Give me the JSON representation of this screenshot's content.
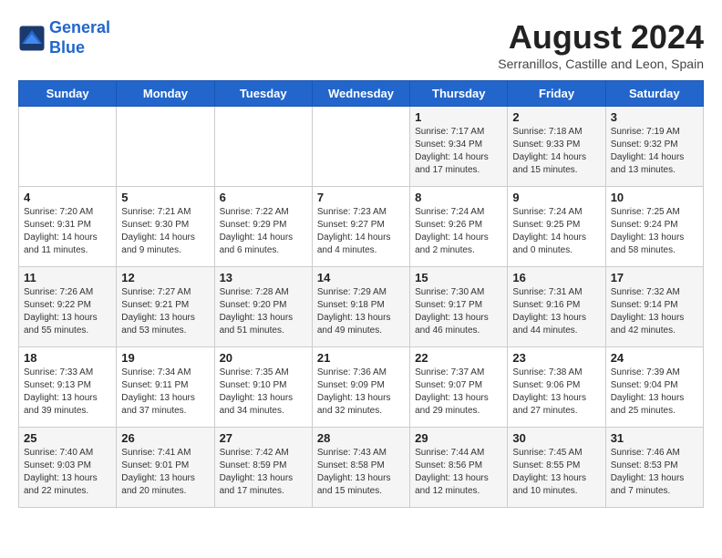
{
  "header": {
    "logo_line1": "General",
    "logo_line2": "Blue",
    "month_title": "August 2024",
    "subtitle": "Serranillos, Castille and Leon, Spain"
  },
  "weekdays": [
    "Sunday",
    "Monday",
    "Tuesday",
    "Wednesday",
    "Thursday",
    "Friday",
    "Saturday"
  ],
  "weeks": [
    [
      {
        "day": "",
        "info": ""
      },
      {
        "day": "",
        "info": ""
      },
      {
        "day": "",
        "info": ""
      },
      {
        "day": "",
        "info": ""
      },
      {
        "day": "1",
        "info": "Sunrise: 7:17 AM\nSunset: 9:34 PM\nDaylight: 14 hours\nand 17 minutes."
      },
      {
        "day": "2",
        "info": "Sunrise: 7:18 AM\nSunset: 9:33 PM\nDaylight: 14 hours\nand 15 minutes."
      },
      {
        "day": "3",
        "info": "Sunrise: 7:19 AM\nSunset: 9:32 PM\nDaylight: 14 hours\nand 13 minutes."
      }
    ],
    [
      {
        "day": "4",
        "info": "Sunrise: 7:20 AM\nSunset: 9:31 PM\nDaylight: 14 hours\nand 11 minutes."
      },
      {
        "day": "5",
        "info": "Sunrise: 7:21 AM\nSunset: 9:30 PM\nDaylight: 14 hours\nand 9 minutes."
      },
      {
        "day": "6",
        "info": "Sunrise: 7:22 AM\nSunset: 9:29 PM\nDaylight: 14 hours\nand 6 minutes."
      },
      {
        "day": "7",
        "info": "Sunrise: 7:23 AM\nSunset: 9:27 PM\nDaylight: 14 hours\nand 4 minutes."
      },
      {
        "day": "8",
        "info": "Sunrise: 7:24 AM\nSunset: 9:26 PM\nDaylight: 14 hours\nand 2 minutes."
      },
      {
        "day": "9",
        "info": "Sunrise: 7:24 AM\nSunset: 9:25 PM\nDaylight: 14 hours\nand 0 minutes."
      },
      {
        "day": "10",
        "info": "Sunrise: 7:25 AM\nSunset: 9:24 PM\nDaylight: 13 hours\nand 58 minutes."
      }
    ],
    [
      {
        "day": "11",
        "info": "Sunrise: 7:26 AM\nSunset: 9:22 PM\nDaylight: 13 hours\nand 55 minutes."
      },
      {
        "day": "12",
        "info": "Sunrise: 7:27 AM\nSunset: 9:21 PM\nDaylight: 13 hours\nand 53 minutes."
      },
      {
        "day": "13",
        "info": "Sunrise: 7:28 AM\nSunset: 9:20 PM\nDaylight: 13 hours\nand 51 minutes."
      },
      {
        "day": "14",
        "info": "Sunrise: 7:29 AM\nSunset: 9:18 PM\nDaylight: 13 hours\nand 49 minutes."
      },
      {
        "day": "15",
        "info": "Sunrise: 7:30 AM\nSunset: 9:17 PM\nDaylight: 13 hours\nand 46 minutes."
      },
      {
        "day": "16",
        "info": "Sunrise: 7:31 AM\nSunset: 9:16 PM\nDaylight: 13 hours\nand 44 minutes."
      },
      {
        "day": "17",
        "info": "Sunrise: 7:32 AM\nSunset: 9:14 PM\nDaylight: 13 hours\nand 42 minutes."
      }
    ],
    [
      {
        "day": "18",
        "info": "Sunrise: 7:33 AM\nSunset: 9:13 PM\nDaylight: 13 hours\nand 39 minutes."
      },
      {
        "day": "19",
        "info": "Sunrise: 7:34 AM\nSunset: 9:11 PM\nDaylight: 13 hours\nand 37 minutes."
      },
      {
        "day": "20",
        "info": "Sunrise: 7:35 AM\nSunset: 9:10 PM\nDaylight: 13 hours\nand 34 minutes."
      },
      {
        "day": "21",
        "info": "Sunrise: 7:36 AM\nSunset: 9:09 PM\nDaylight: 13 hours\nand 32 minutes."
      },
      {
        "day": "22",
        "info": "Sunrise: 7:37 AM\nSunset: 9:07 PM\nDaylight: 13 hours\nand 29 minutes."
      },
      {
        "day": "23",
        "info": "Sunrise: 7:38 AM\nSunset: 9:06 PM\nDaylight: 13 hours\nand 27 minutes."
      },
      {
        "day": "24",
        "info": "Sunrise: 7:39 AM\nSunset: 9:04 PM\nDaylight: 13 hours\nand 25 minutes."
      }
    ],
    [
      {
        "day": "25",
        "info": "Sunrise: 7:40 AM\nSunset: 9:03 PM\nDaylight: 13 hours\nand 22 minutes."
      },
      {
        "day": "26",
        "info": "Sunrise: 7:41 AM\nSunset: 9:01 PM\nDaylight: 13 hours\nand 20 minutes."
      },
      {
        "day": "27",
        "info": "Sunrise: 7:42 AM\nSunset: 8:59 PM\nDaylight: 13 hours\nand 17 minutes."
      },
      {
        "day": "28",
        "info": "Sunrise: 7:43 AM\nSunset: 8:58 PM\nDaylight: 13 hours\nand 15 minutes."
      },
      {
        "day": "29",
        "info": "Sunrise: 7:44 AM\nSunset: 8:56 PM\nDaylight: 13 hours\nand 12 minutes."
      },
      {
        "day": "30",
        "info": "Sunrise: 7:45 AM\nSunset: 8:55 PM\nDaylight: 13 hours\nand 10 minutes."
      },
      {
        "day": "31",
        "info": "Sunrise: 7:46 AM\nSunset: 8:53 PM\nDaylight: 13 hours\nand 7 minutes."
      }
    ]
  ]
}
